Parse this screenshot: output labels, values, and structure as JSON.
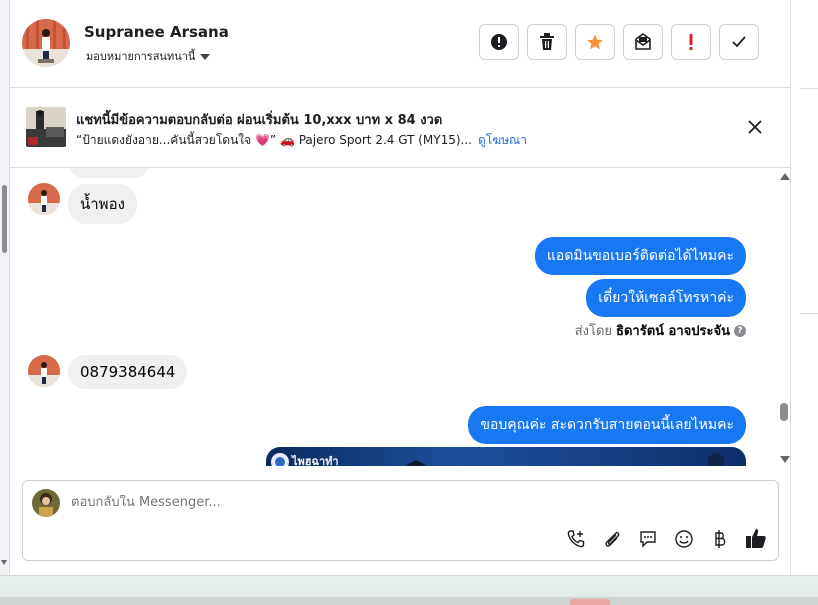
{
  "header": {
    "contact_name": "Supranee Arsana",
    "assign_label": "มอบหมายการสนทนานี้",
    "actions": [
      {
        "name": "spam",
        "icon": "alert-circle-icon"
      },
      {
        "name": "delete",
        "icon": "trash-icon"
      },
      {
        "name": "star",
        "icon": "star-icon",
        "color": "#f7923a"
      },
      {
        "name": "mark-unread",
        "icon": "envelope-icon"
      },
      {
        "name": "follow-up",
        "icon": "exclamation-icon",
        "color": "#e02020"
      },
      {
        "name": "done",
        "icon": "check-icon"
      }
    ]
  },
  "ad": {
    "title": "แชทนี้มีข้อความตอบกลับต่อ ผ่อนเริ่มต้น 10,xxx บาท x 84 งวด",
    "subtitle": "“ป้ายแดงยังอาย...คันนี้สวยโดนใจ 💗” 🚗 Pajero Sport 2.4 GT (MY15)...",
    "link": "ดูโฆษณา"
  },
  "messages": {
    "in_1": "น้ำพอง",
    "out_1": "แอดมินขอเบอร์ติดต่อได้ไหมคะ",
    "out_2": "เดี๋ยวให้เซลล์โทรหาค่ะ",
    "sent_by_label": "ส่งโดย",
    "sent_by_name": "ธิดารัตน์ อาจประจัน",
    "in_2": "0879384644",
    "out_3": "ขอบคุณค่ะ สะดวกรับสายตอนนี้เลยไหมคะ",
    "image_caption": "ไพฮฉาทำ"
  },
  "composer": {
    "placeholder": "ตอบกลับใน Messenger...",
    "icons": [
      "phone-plus-icon",
      "paperclip-icon",
      "saved-reply-icon",
      "emoji-icon",
      "baht-icon",
      "thumbs-up-icon"
    ]
  },
  "colors": {
    "accent": "#1877f2",
    "star": "#f7923a",
    "alert": "#e02020",
    "link": "#216fdb"
  }
}
